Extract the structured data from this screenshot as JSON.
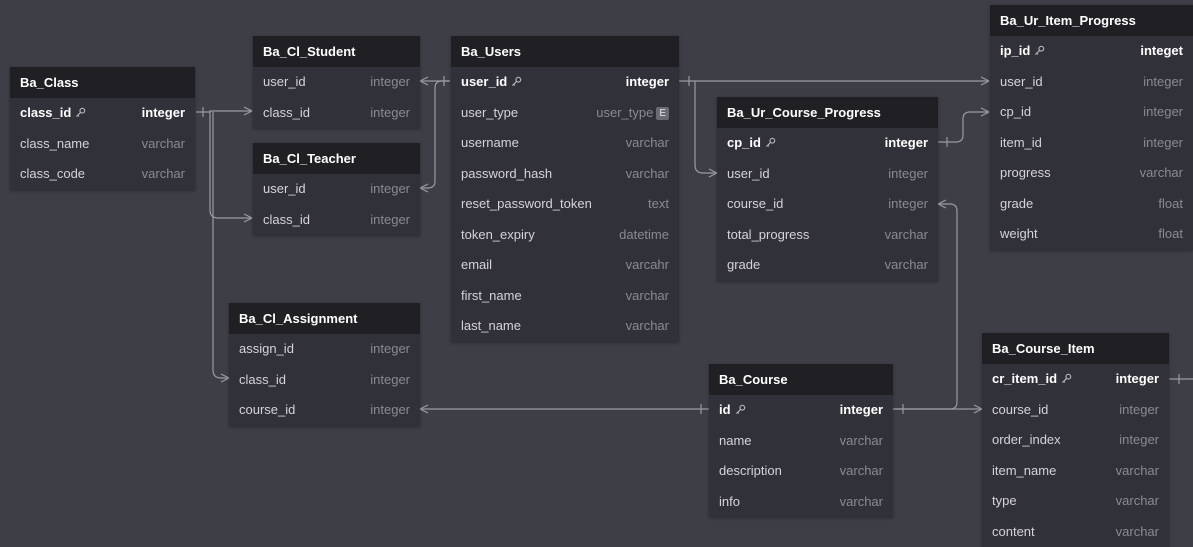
{
  "tables": [
    {
      "id": "ba_class",
      "title": "Ba_Class",
      "fields": [
        {
          "name": "class_id",
          "type": "integer",
          "pk": true
        },
        {
          "name": "class_name",
          "type": "varchar"
        },
        {
          "name": "class_code",
          "type": "varchar"
        }
      ]
    },
    {
      "id": "ba_cl_student",
      "title": "Ba_Cl_Student",
      "fields": [
        {
          "name": "user_id",
          "type": "integer"
        },
        {
          "name": "class_id",
          "type": "integer"
        }
      ]
    },
    {
      "id": "ba_cl_teacher",
      "title": "Ba_Cl_Teacher",
      "fields": [
        {
          "name": "user_id",
          "type": "integer"
        },
        {
          "name": "class_id",
          "type": "integer"
        }
      ]
    },
    {
      "id": "ba_cl_assignment",
      "title": "Ba_Cl_Assignment",
      "fields": [
        {
          "name": "assign_id",
          "type": "integer"
        },
        {
          "name": "class_id",
          "type": "integer"
        },
        {
          "name": "course_id",
          "type": "integer"
        }
      ]
    },
    {
      "id": "ba_users",
      "title": "Ba_Users",
      "fields": [
        {
          "name": "user_id",
          "type": "integer",
          "pk": true
        },
        {
          "name": "user_type",
          "type": "user_type",
          "badge": "E"
        },
        {
          "name": "username",
          "type": "varchar"
        },
        {
          "name": "password_hash",
          "type": "varchar"
        },
        {
          "name": "reset_password_token",
          "type": "text"
        },
        {
          "name": "token_expiry",
          "type": "datetime"
        },
        {
          "name": "email",
          "type": "varcahr"
        },
        {
          "name": "first_name",
          "type": "varchar"
        },
        {
          "name": "last_name",
          "type": "varchar"
        }
      ]
    },
    {
      "id": "ba_ur_course_progress",
      "title": "Ba_Ur_Course_Progress",
      "fields": [
        {
          "name": "cp_id",
          "type": "integer",
          "pk": true
        },
        {
          "name": "user_id",
          "type": "integer"
        },
        {
          "name": "course_id",
          "type": "integer"
        },
        {
          "name": "total_progress",
          "type": "varchar"
        },
        {
          "name": "grade",
          "type": "varchar"
        }
      ]
    },
    {
      "id": "ba_course",
      "title": "Ba_Course",
      "fields": [
        {
          "name": "id",
          "type": "integer",
          "pk": true
        },
        {
          "name": "name",
          "type": "varchar"
        },
        {
          "name": "description",
          "type": "varchar"
        },
        {
          "name": "info",
          "type": "varchar"
        }
      ]
    },
    {
      "id": "ba_ur_item_progress",
      "title": "Ba_Ur_Item_Progress",
      "fields": [
        {
          "name": "ip_id",
          "type": "integet",
          "pk": true
        },
        {
          "name": "user_id",
          "type": "integer"
        },
        {
          "name": "cp_id",
          "type": "integer"
        },
        {
          "name": "item_id",
          "type": "integer"
        },
        {
          "name": "progress",
          "type": "varchar"
        },
        {
          "name": "grade",
          "type": "float"
        },
        {
          "name": "weight",
          "type": "float"
        }
      ]
    },
    {
      "id": "ba_course_item",
      "title": "Ba_Course_Item",
      "fields": [
        {
          "name": "cr_item_id",
          "type": "integer",
          "pk": true
        },
        {
          "name": "course_id",
          "type": "integer"
        },
        {
          "name": "order_index",
          "type": "integer"
        },
        {
          "name": "item_name",
          "type": "varchar"
        },
        {
          "name": "type",
          "type": "varchar"
        },
        {
          "name": "content",
          "type": "varchar"
        }
      ]
    }
  ],
  "icons": {
    "primary_key": "key-icon",
    "enum": "enum-badge"
  },
  "colors": {
    "background": "#3e3e47",
    "table_body": "#31313a",
    "table_header": "#1f1f24",
    "connector": "#9a9aa3"
  }
}
